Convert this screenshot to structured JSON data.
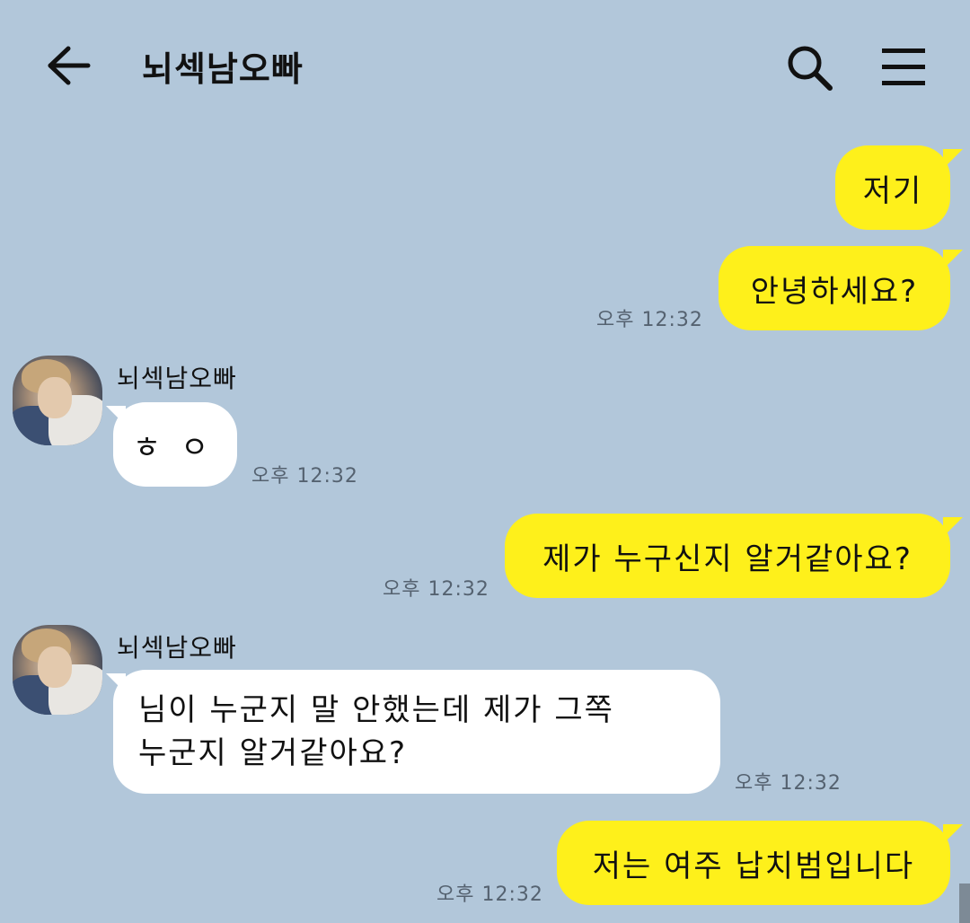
{
  "header": {
    "title": "뇌섹남오빠",
    "back_icon": "arrow-left-icon",
    "search_icon": "search-icon",
    "menu_icon": "hamburger-menu-icon"
  },
  "colors": {
    "background": "#b2c7da",
    "my_bubble": "#fef01b",
    "their_bubble": "#ffffff"
  },
  "messages": [
    {
      "from": "me",
      "text": "저기",
      "time": ""
    },
    {
      "from": "me",
      "text": "안녕하세요?",
      "time": "오후 12:32"
    },
    {
      "from": "them",
      "sender": "뇌섹남오빠",
      "text": "ㅎㅇ",
      "time": "오후 12:32"
    },
    {
      "from": "me",
      "text": "제가 누구신지 알거같아요?",
      "time": "오후 12:32"
    },
    {
      "from": "them",
      "sender": "뇌섹남오빠",
      "text_lines": [
        "님이 누군지 말 안했는데 제가 그쪽",
        "누군지 알거같아요?"
      ],
      "time": "오후 12:32"
    },
    {
      "from": "me",
      "text": "저는 여주 납치범입니다",
      "time": "오후 12:32"
    }
  ]
}
